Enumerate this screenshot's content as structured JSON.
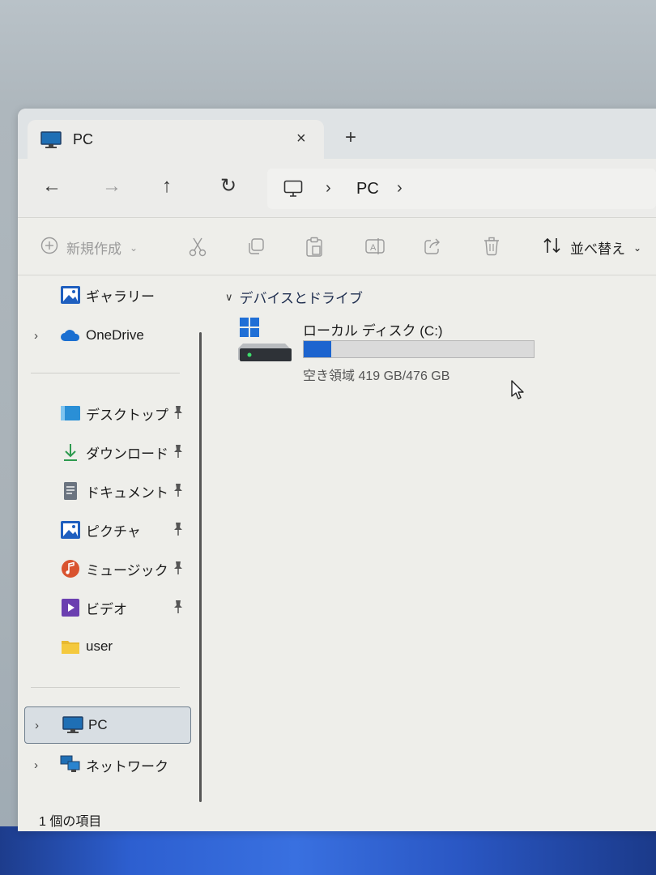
{
  "tab": {
    "title": "PC",
    "close_icon": "×",
    "new_tab_icon": "+"
  },
  "nav": {
    "back": "←",
    "forward": "→",
    "up": "↑",
    "refresh": "↻",
    "breadcrumb_sep": "›",
    "address": "PC"
  },
  "commands": {
    "new_label": "新規作成",
    "sort_label": "並べ替え"
  },
  "sidebar": {
    "top_items": [
      {
        "label": "ギャラリー"
      },
      {
        "label": "OneDrive"
      }
    ],
    "quick_access": [
      {
        "label": "デスクトップ"
      },
      {
        "label": "ダウンロード"
      },
      {
        "label": "ドキュメント"
      },
      {
        "label": "ピクチャ"
      },
      {
        "label": "ミュージック"
      },
      {
        "label": "ビデオ"
      },
      {
        "label": "user"
      }
    ],
    "bottom_items": [
      {
        "label": "PC"
      },
      {
        "label": "ネットワーク"
      }
    ],
    "chevron": "›"
  },
  "content": {
    "group_label": "デバイスとドライブ",
    "drive": {
      "name": "ローカル ディスク (C:)",
      "free_text": "空き領域 419 GB/476 GB",
      "used_fraction": 0.12
    }
  },
  "status": {
    "item_count": "1 個の項目"
  },
  "colors": {
    "accent": "#1c64cf",
    "window_bg": "#eeeeea"
  }
}
